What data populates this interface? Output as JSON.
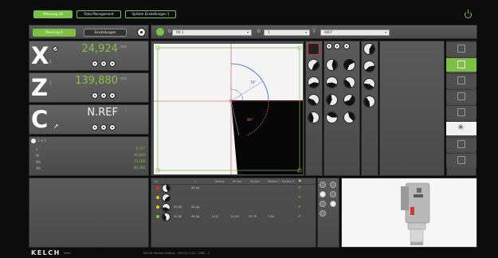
{
  "top_tabs": [
    "Messung 1B",
    "Data Management",
    "System Einstellungen 1"
  ],
  "power_icon": "power-icon",
  "left_tabs": [
    "Messung A",
    "Einstellungen"
  ],
  "axes": [
    {
      "letter": "X",
      "value": "24,924",
      "unit": "mm",
      "sub": "1"
    },
    {
      "letter": "Z",
      "value": "139,880",
      "unit": "mm",
      "sub": "1"
    },
    {
      "letter": "C",
      "value": "N.REF",
      "unit": "°",
      "sub": ""
    }
  ],
  "extra_panel": {
    "header": "1  ⊕ 1",
    "rows": [
      {
        "label": "x",
        "value": "0,717"
      },
      {
        "label": "W",
        "value": "45,828"
      },
      {
        "label": "Wx",
        "value": "73,198"
      },
      {
        "label": "Wz",
        "value": "84,780"
      }
    ]
  },
  "dropdowns": [
    {
      "label": "OK 1",
      "value": "1"
    },
    {
      "label": "1",
      "value": ""
    },
    {
      "label": "0007",
      "value": ""
    }
  ],
  "table": {
    "headers": [
      "Nr",
      "√",
      "Radius",
      "W-mw",
      "W-max",
      "Radius I",
      "Radius II"
    ],
    "rows": [
      {
        "color": "#d9302b",
        "c1": "",
        "c2": "",
        "c3": "90,4g",
        "c4": "",
        "c5": "",
        "c6": "",
        "c7": "",
        "check": "✔"
      },
      {
        "color": "#e8c31d",
        "c1": "",
        "c2": "",
        "c3": "",
        "c4": "",
        "c5": "",
        "c6": "",
        "c7": "",
        "check": "✔"
      },
      {
        "color": "#e8c31d",
        "c1": "",
        "c2": "90,06",
        "c3": "90,4g",
        "c4": "",
        "c5": "",
        "c6": "",
        "c7": "",
        "check": "✔"
      },
      {
        "color": "#84c441",
        "c1": "",
        "c2": "90,06",
        "c3": "90,4g",
        "c4": "0,03",
        "c5": "0,020",
        "c6": "30,70",
        "c7": "7,64",
        "check": "✔"
      }
    ]
  },
  "footer": {
    "logo": "KELCH",
    "logo_sub": "xline",
    "service": "KELCH Service-Hotline: +49 (0) 7151 / 2082 - 2"
  },
  "canvas_labels": {
    "arc1": "78°",
    "arc2": "90°"
  },
  "colors": {
    "accent": "#7cc242",
    "bg": "#0c0c0c",
    "panel": "#555555",
    "red_axis": "#e03b3b",
    "blue_arc": "#2d58c6",
    "orange_arc": "#e0952a"
  }
}
